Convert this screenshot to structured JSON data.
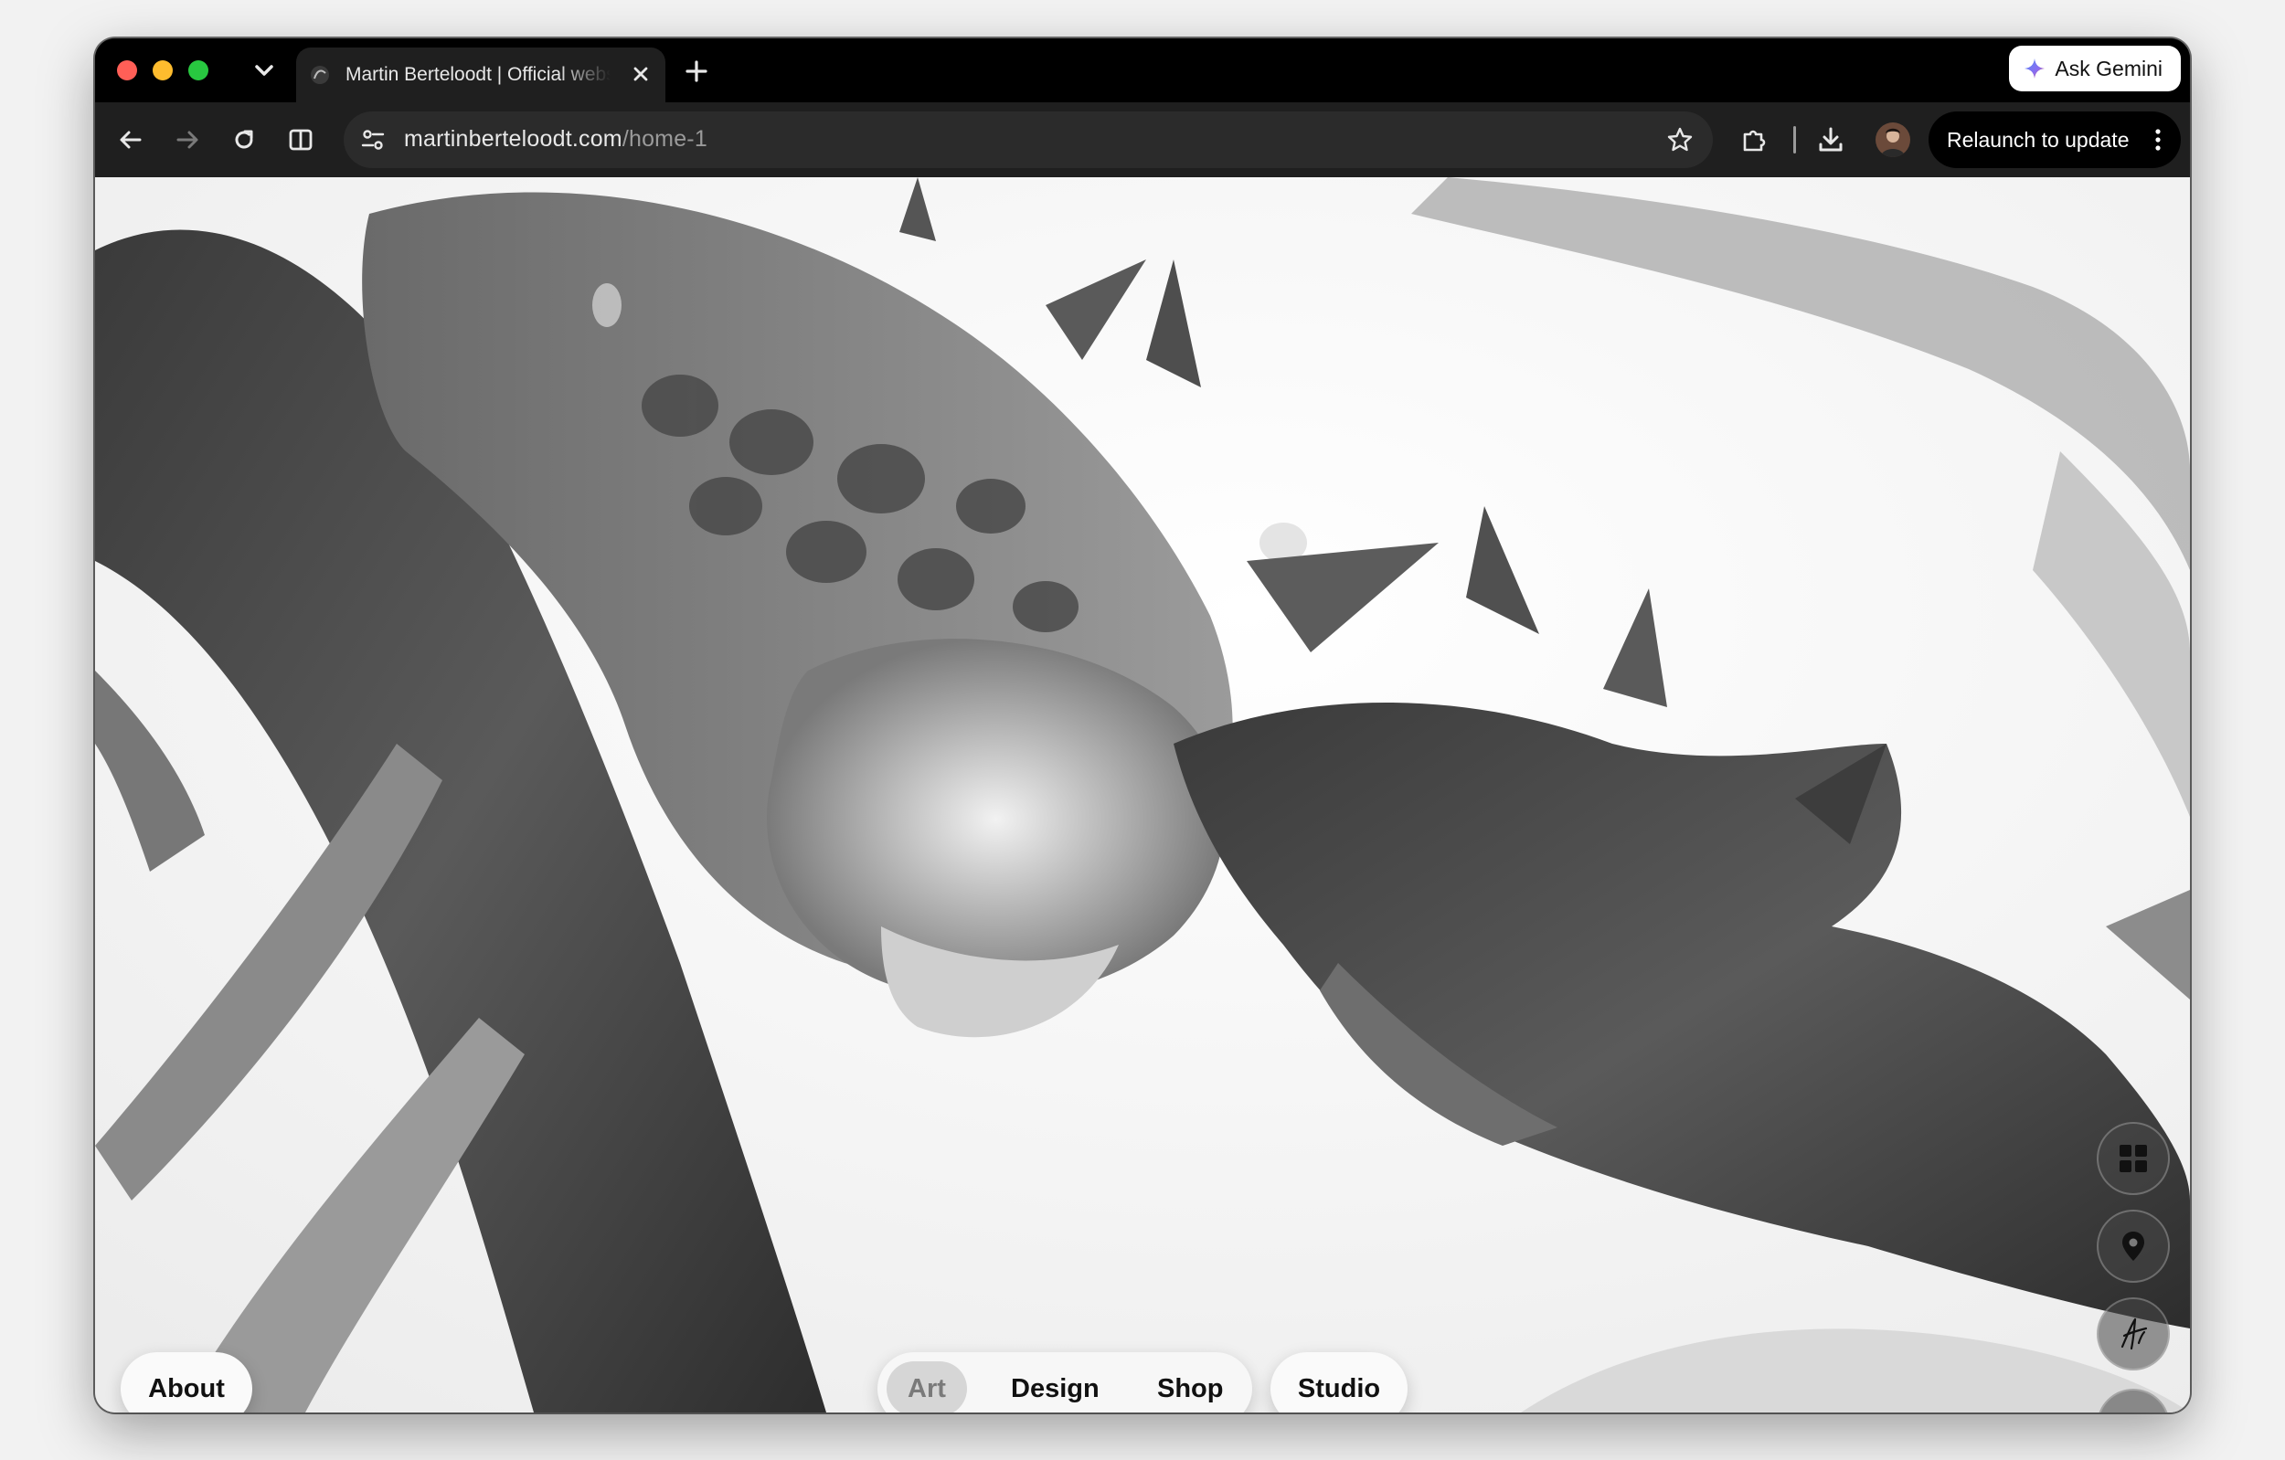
{
  "browser": {
    "tab": {
      "title": "Martin Berteloodt | Official website"
    },
    "ask_gemini_label": "Ask Gemini",
    "url": {
      "domain": "martinberteloodt.com",
      "path": "/home-1"
    },
    "relaunch_label": "Relaunch to update"
  },
  "page": {
    "about_label": "About",
    "nav": [
      {
        "label": "Art",
        "selected": true
      },
      {
        "label": "Design",
        "selected": false
      },
      {
        "label": "Shop",
        "selected": false
      }
    ],
    "studio_label": "Studio",
    "side_buttons": [
      "grid-icon",
      "location-pin-icon",
      "signature-icon",
      "arrow-up-icon"
    ]
  },
  "colors": {
    "tab_strip": "#000000",
    "toolbar": "#1f1f1f",
    "omnibox": "#2b2b2b",
    "page_background": "#ffffff",
    "pill_background": "#fafafa",
    "selected_nav": "#d6d6d6"
  }
}
